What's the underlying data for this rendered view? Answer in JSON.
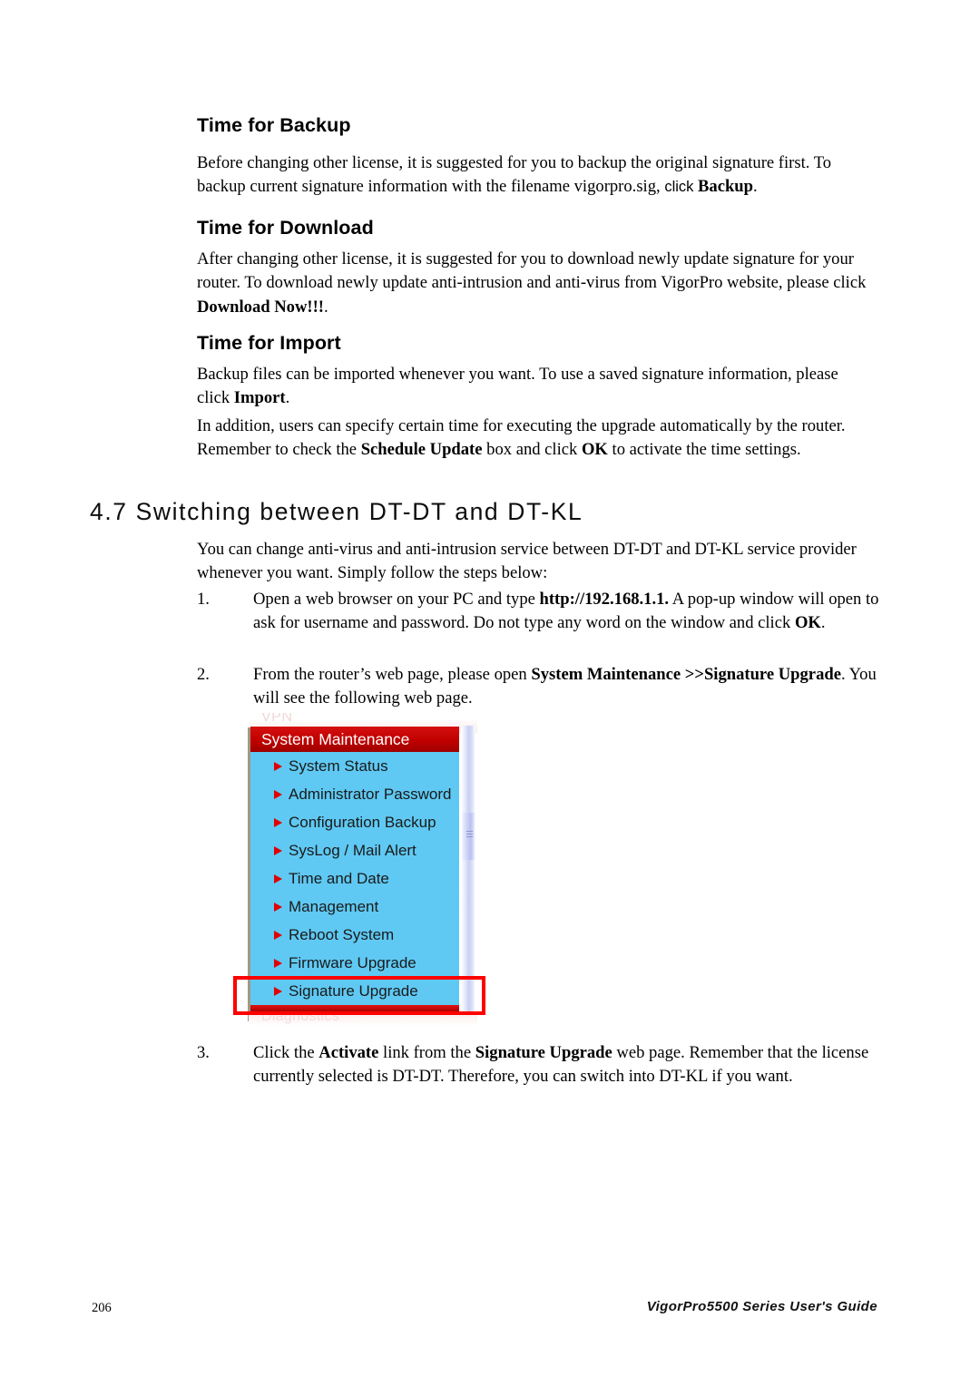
{
  "sections": {
    "backup": {
      "heading": "Time for Backup",
      "paragraph_prefix": "Before changing other license, it is suggested for you to backup the original signature first. To backup current signature information with the filename vigorpro.sig, ",
      "paragraph_click": "click ",
      "paragraph_bold": "Backup",
      "paragraph_suffix": "."
    },
    "download": {
      "heading": "Time for Download",
      "paragraph_prefix": "After changing other license, it is suggested for you to download newly update signature for your router. To download newly update anti-intrusion and anti-virus from VigorPro website, please click ",
      "paragraph_bold": "Download Now!!!",
      "paragraph_suffix": "."
    },
    "import": {
      "heading": "Time for Import",
      "paragraph1_prefix": "Backup files can be imported whenever you want. To use a saved signature information, please click ",
      "paragraph1_bold": "Import",
      "paragraph1_suffix": ".",
      "paragraph2_prefix": "In addition, users can specify certain time for executing the upgrade automatically by the router. Remember to check the ",
      "paragraph2_bold1": "Schedule Update",
      "paragraph2_mid": " box and click ",
      "paragraph2_bold2": "OK",
      "paragraph2_suffix": " to activate the time settings."
    }
  },
  "chapter": {
    "heading": "4.7 Switching between DT-DT and DT-KL",
    "intro": "You can change anti-virus and anti-intrusion service between DT-DT and DT-KL service provider whenever you want. Simply follow the steps below:",
    "steps": [
      {
        "number": "1.",
        "prefix": "Open a web browser on your PC and type ",
        "bold1": "http://192.168.1.1.",
        "mid": " A pop-up window will open to ask for username and password. Do not type any word on the window and click ",
        "bold2": "OK",
        "suffix": "."
      },
      {
        "number": "2.",
        "prefix": "From the router’s web page, please open ",
        "bold1": "System Maintenance >>Signature Upgrade",
        "mid": ". You will see the following web page.",
        "bold2": "",
        "suffix": ""
      },
      {
        "number": "3.",
        "prefix": "Click the ",
        "bold1": "Activate",
        "mid": " link from the ",
        "bold2": "Signature Upgrade",
        "suffix": " web page. Remember that the license currently selected is DT-DT. Therefore, you can switch into DT-KL if you want."
      }
    ]
  },
  "router_menu": {
    "faded_above": "VPN",
    "title": "System Maintenance",
    "items": [
      {
        "label": "System Status",
        "highlighted": false
      },
      {
        "label": "Administrator Password",
        "highlighted": false
      },
      {
        "label": "Configuration Backup",
        "highlighted": false
      },
      {
        "label": "SysLog / Mail Alert",
        "highlighted": false
      },
      {
        "label": "Time and Date",
        "highlighted": false
      },
      {
        "label": "Management",
        "highlighted": false
      },
      {
        "label": "Reboot System",
        "highlighted": false
      },
      {
        "label": "Firmware Upgrade",
        "highlighted": false
      },
      {
        "label": "Signature Upgrade",
        "highlighted": true
      }
    ],
    "faded_below": "Diagnostics",
    "colors": {
      "title_bar": "#c00000",
      "menu_background": "#5fc9f3",
      "bullet": "#e00000",
      "highlight_border": "#ff0000"
    }
  },
  "footer": {
    "page_number": "206",
    "guide_title": "VigorPro5500 Series User's Guide"
  }
}
